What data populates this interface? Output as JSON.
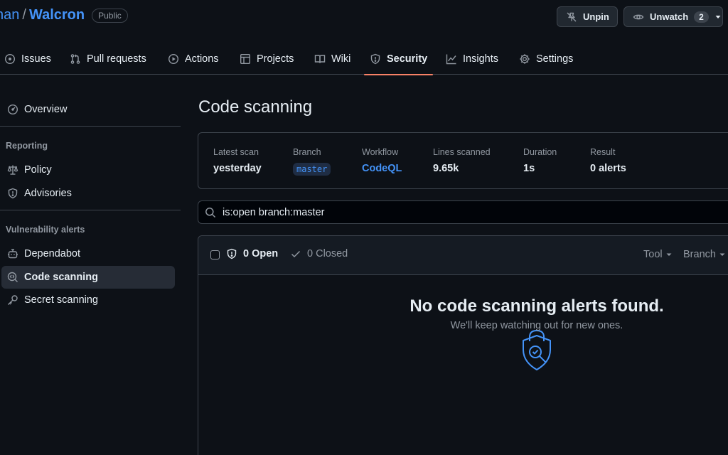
{
  "repo": {
    "owner_fragment": "nan",
    "separator": "/",
    "name": "Walcron",
    "visibility": "Public"
  },
  "header_actions": {
    "unpin": "Unpin",
    "unwatch": "Unwatch",
    "watch_count": "2"
  },
  "tabs": [
    {
      "label": "Issues",
      "icon": "issue-opened-icon"
    },
    {
      "label": "Pull requests",
      "icon": "git-pull-request-icon"
    },
    {
      "label": "Actions",
      "icon": "play-icon"
    },
    {
      "label": "Projects",
      "icon": "table-icon"
    },
    {
      "label": "Wiki",
      "icon": "book-icon"
    },
    {
      "label": "Security",
      "icon": "shield-icon",
      "active": true
    },
    {
      "label": "Insights",
      "icon": "graph-icon"
    },
    {
      "label": "Settings",
      "icon": "gear-icon"
    }
  ],
  "sidebar": {
    "overview": "Overview",
    "reporting_heading": "Reporting",
    "policy": "Policy",
    "advisories": "Advisories",
    "vuln_heading": "Vulnerability alerts",
    "dependabot": "Dependabot",
    "code_scanning": "Code scanning",
    "secret_scanning": "Secret scanning"
  },
  "main": {
    "title": "Code scanning",
    "scan": {
      "latest_scan_label": "Latest scan",
      "latest_scan_value": "yesterday",
      "branch_label": "Branch",
      "branch_value": "master",
      "workflow_label": "Workflow",
      "workflow_value": "CodeQL",
      "lines_label": "Lines scanned",
      "lines_value": "9.65k",
      "duration_label": "Duration",
      "duration_value": "1s",
      "result_label": "Result",
      "result_value": "0 alerts"
    },
    "search": {
      "value": "is:open branch:master"
    },
    "alerts": {
      "open_label": "0 Open",
      "closed_label": "0 Closed",
      "tool_filter": "Tool",
      "branch_filter": "Branch"
    },
    "empty": {
      "title": "No code scanning alerts found.",
      "subtitle": "We'll keep watching out for new ones."
    }
  },
  "colors": {
    "accent": "#4493f8",
    "tab_underline": "#f78166",
    "background": "#0d1117"
  }
}
